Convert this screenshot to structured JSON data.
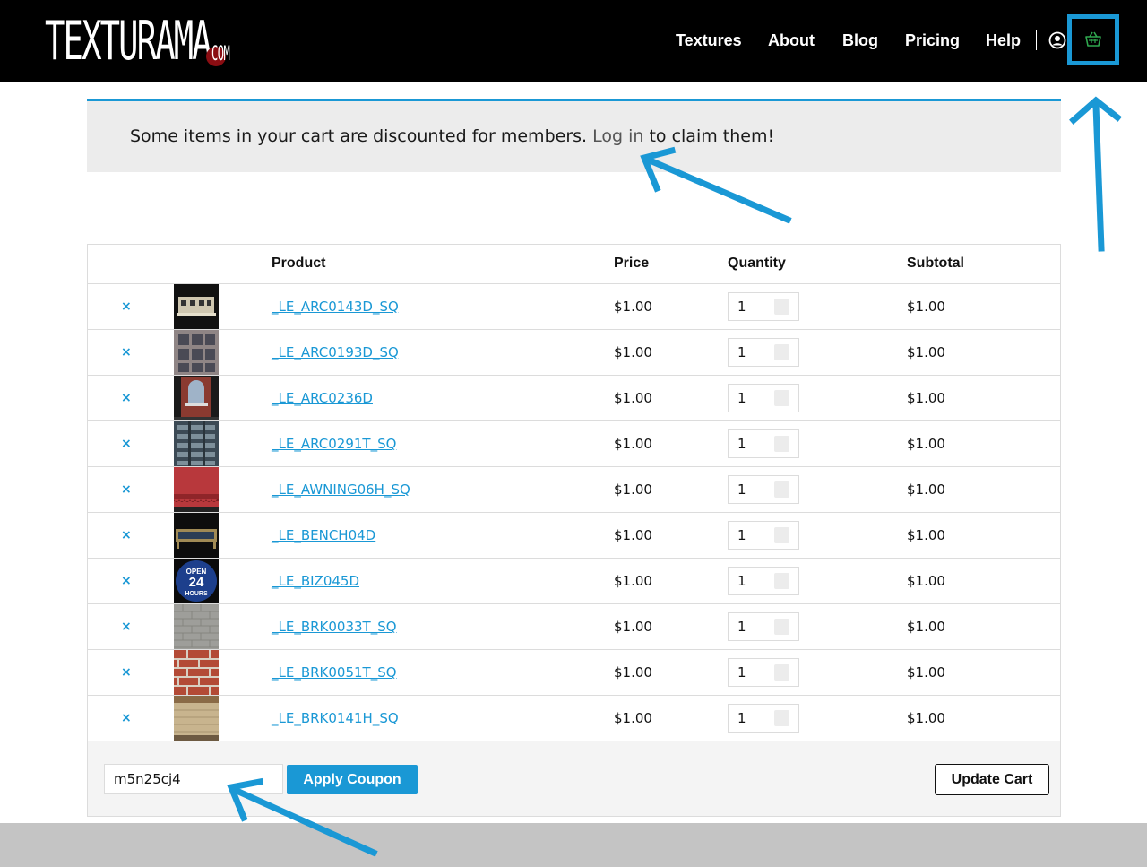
{
  "header": {
    "logo_text": "TEXTURAMA",
    "logo_suffix": "COM",
    "nav": [
      {
        "label": "Textures"
      },
      {
        "label": "About"
      },
      {
        "label": "Blog"
      },
      {
        "label": "Pricing"
      },
      {
        "label": "Help"
      }
    ],
    "icons": {
      "account": "user-circle-icon",
      "cart": "basket-icon"
    },
    "accent_color": "#1a98d5",
    "cart_icon_color": "#2fa84f"
  },
  "notice": {
    "text_before": "Some items in your cart are discounted for members.",
    "link_label": "Log in",
    "text_after": "to claim them!"
  },
  "cart": {
    "columns": {
      "product": "Product",
      "price": "Price",
      "quantity": "Quantity",
      "subtotal": "Subtotal"
    },
    "remove_glyph": "×",
    "items": [
      {
        "name": "_LE_ARC0143D_SQ",
        "price": "$1.00",
        "qty": "1",
        "subtotal": "$1.00"
      },
      {
        "name": "_LE_ARC0193D_SQ",
        "price": "$1.00",
        "qty": "1",
        "subtotal": "$1.00"
      },
      {
        "name": "_LE_ARC0236D",
        "price": "$1.00",
        "qty": "1",
        "subtotal": "$1.00"
      },
      {
        "name": "_LE_ARC0291T_SQ",
        "price": "$1.00",
        "qty": "1",
        "subtotal": "$1.00"
      },
      {
        "name": "_LE_AWNING06H_SQ",
        "price": "$1.00",
        "qty": "1",
        "subtotal": "$1.00"
      },
      {
        "name": "_LE_BENCH04D",
        "price": "$1.00",
        "qty": "1",
        "subtotal": "$1.00"
      },
      {
        "name": "_LE_BIZ045D",
        "price": "$1.00",
        "qty": "1",
        "subtotal": "$1.00",
        "thumb_text": [
          "OPEN",
          "24",
          "HOURS"
        ]
      },
      {
        "name": "_LE_BRK0033T_SQ",
        "price": "$1.00",
        "qty": "1",
        "subtotal": "$1.00"
      },
      {
        "name": "_LE_BRK0051T_SQ",
        "price": "$1.00",
        "qty": "1",
        "subtotal": "$1.00"
      },
      {
        "name": "_LE_BRK0141H_SQ",
        "price": "$1.00",
        "qty": "1",
        "subtotal": "$1.00"
      }
    ],
    "coupon_value": "m5n25cj4",
    "apply_label": "Apply Coupon",
    "update_label": "Update Cart"
  }
}
